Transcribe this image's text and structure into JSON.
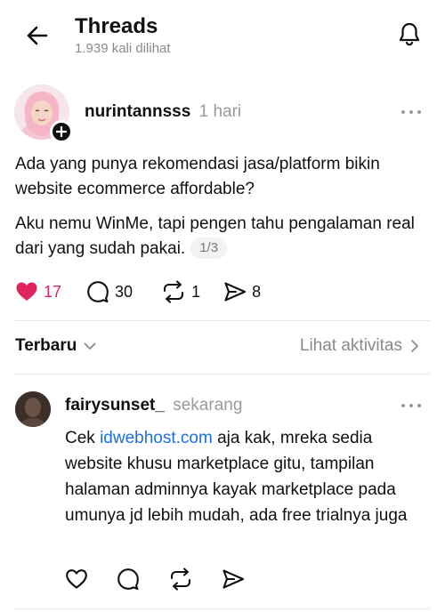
{
  "header": {
    "title": "Threads",
    "views": "1.939 kali dilihat"
  },
  "post": {
    "username": "nurintannsss",
    "time": "1 hari",
    "text_1": "Ada yang punya rekomendasi jasa/platform bikin website ecommerce affordable?",
    "text_2": "Aku nemu WinMe, tapi pengen tahu pengalaman real dari yang sudah pakai.",
    "page_indicator": "1/3",
    "likes": "17",
    "replies": "30",
    "reposts": "1",
    "shares": "8",
    "liked": true
  },
  "sort": {
    "label": "Terbaru",
    "activity_link": "Lihat aktivitas"
  },
  "reply": {
    "username": "fairysunset_",
    "time": "sekarang",
    "text_before": "Cek ",
    "link": "idwebhost.com",
    "text_after": " aja kak, mreka sedia website khusu marketplace gitu, tampilan halaman adminnya kayak marketplace pada umunya jd lebih mudah, ada free trialnya juga"
  },
  "colors": {
    "like_red": "#e0245e",
    "link_blue": "#1d6fe0",
    "muted_gray": "#8a8a8a"
  },
  "icons": [
    "back-arrow-icon",
    "bell-icon",
    "plus-icon",
    "more-icon",
    "heart-icon",
    "comment-icon",
    "repost-icon",
    "share-icon",
    "chevron-down-icon",
    "chevron-right-icon"
  ]
}
